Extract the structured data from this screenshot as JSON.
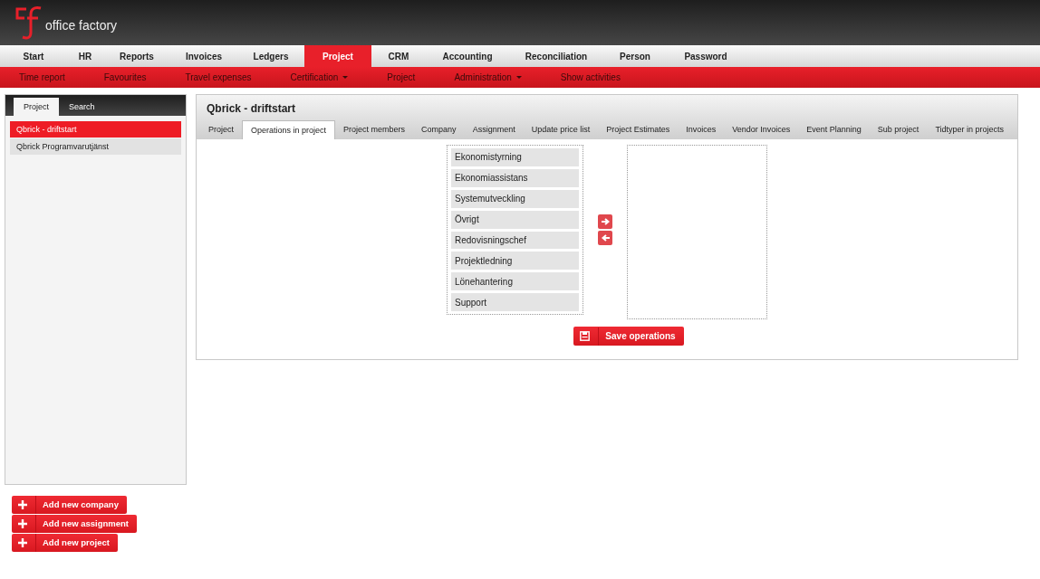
{
  "logo": {
    "text": "office factory"
  },
  "main_nav": [
    {
      "label": "Start",
      "selected": false
    },
    {
      "label": "HR",
      "selected": false
    },
    {
      "label": "Reports",
      "selected": false
    },
    {
      "label": "Invoices",
      "selected": false
    },
    {
      "label": "Ledgers",
      "selected": false
    },
    {
      "label": "Project",
      "selected": true
    },
    {
      "label": "CRM",
      "selected": false
    },
    {
      "label": "Accounting",
      "selected": false
    },
    {
      "label": "Reconciliation",
      "selected": false
    },
    {
      "label": "Person",
      "selected": false
    },
    {
      "label": "Password",
      "selected": false
    }
  ],
  "sub_nav": [
    {
      "label": "Time report",
      "dropdown": false
    },
    {
      "label": "Favourites",
      "dropdown": false
    },
    {
      "label": "Travel expenses",
      "dropdown": false
    },
    {
      "label": "Certification",
      "dropdown": true
    },
    {
      "label": "Project",
      "dropdown": false
    },
    {
      "label": "Administration",
      "dropdown": true
    },
    {
      "label": "Show activities",
      "dropdown": false
    }
  ],
  "sidebar": {
    "tabs": [
      {
        "label": "Project",
        "selected": true
      },
      {
        "label": "Search",
        "selected": false
      }
    ],
    "items": [
      {
        "label": "Qbrick - driftstart",
        "selected": true
      },
      {
        "label": "Qbrick Programvarutjänst",
        "selected": false
      }
    ]
  },
  "actions": [
    "Add new company",
    "Add new assignment",
    "Add new project"
  ],
  "main": {
    "title": "Qbrick - driftstart",
    "tabs": [
      {
        "label": "Project",
        "selected": false
      },
      {
        "label": "Operations in project",
        "selected": true
      },
      {
        "label": "Project members",
        "selected": false
      },
      {
        "label": "Company",
        "selected": false
      },
      {
        "label": "Assignment",
        "selected": false
      },
      {
        "label": "Update price list",
        "selected": false
      },
      {
        "label": "Project Estimates",
        "selected": false
      },
      {
        "label": "Invoices",
        "selected": false
      },
      {
        "label": "Vendor Invoices",
        "selected": false
      },
      {
        "label": "Event Planning",
        "selected": false
      },
      {
        "label": "Sub project",
        "selected": false
      },
      {
        "label": "Tidtyper in projects",
        "selected": false
      }
    ],
    "available_operations": [
      "Ekonomistyrning",
      "Ekonomiassistans",
      "Systemutveckling",
      "Övrigt",
      "Redovisningschef",
      "Projektledning",
      "Lönehantering",
      "Support"
    ],
    "save_button": "Save operations"
  }
}
